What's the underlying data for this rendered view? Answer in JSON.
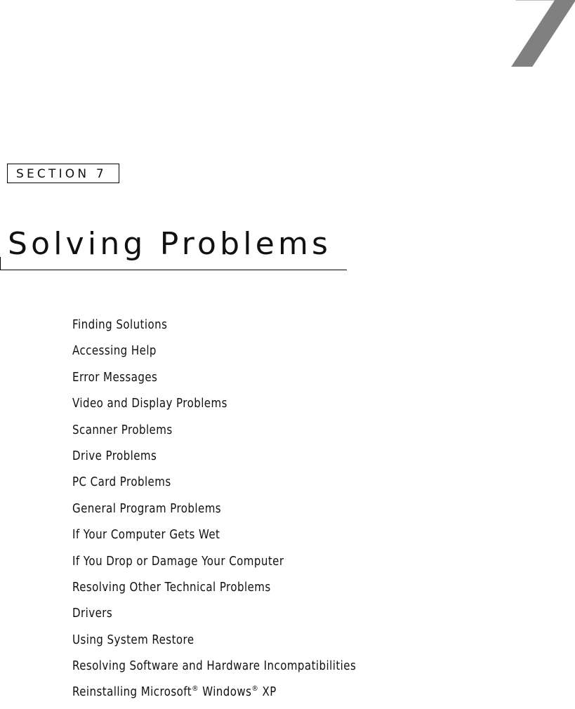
{
  "chapter": {
    "number": "7",
    "section_label": "SECTION 7",
    "title": "Solving Problems",
    "number_color": "#808080"
  },
  "toc": {
    "items": [
      "Finding Solutions",
      "Accessing Help",
      "Error Messages",
      "Video and Display Problems",
      "Scanner Problems",
      "Drive Problems",
      "PC Card Problems",
      "General Program Problems",
      "If Your Computer Gets Wet",
      "If You Drop or Damage Your Computer",
      "Resolving Other Technical Problems",
      "Drivers",
      "Using System Restore",
      "Resolving Software and Hardware Incompatibilities"
    ],
    "last_item": {
      "part1": "Reinstalling Microsoft",
      "reg1": "®",
      "part2": " Windows",
      "reg2": "®",
      "part3": " XP"
    }
  }
}
